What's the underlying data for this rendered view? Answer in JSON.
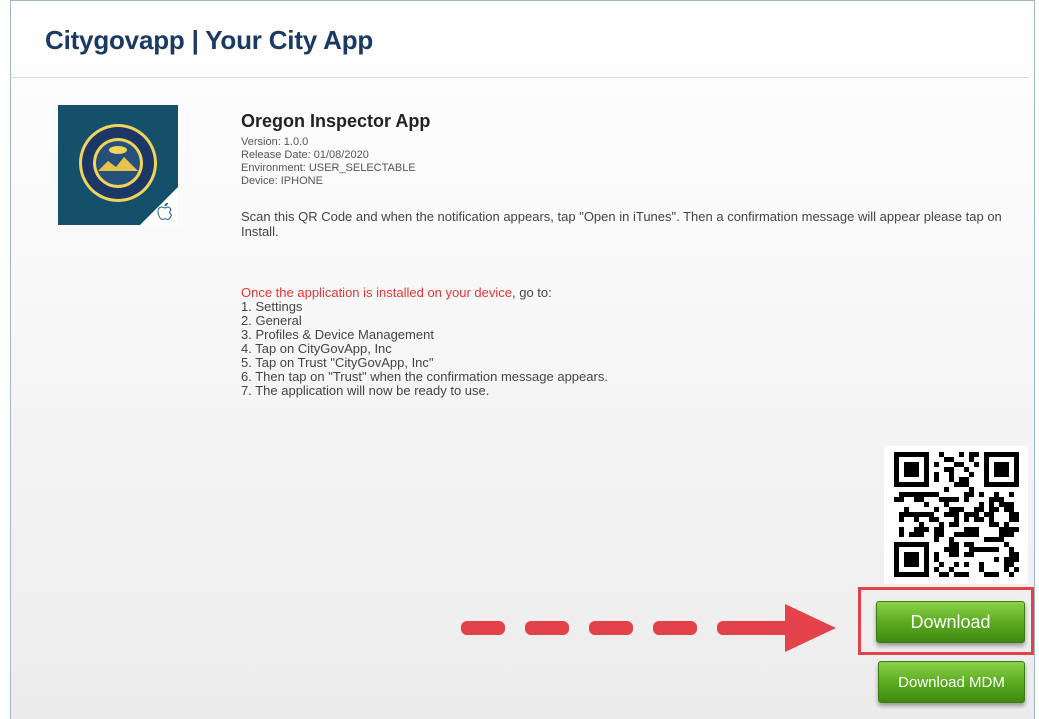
{
  "header": {
    "title": "Citygovapp | Your City App"
  },
  "app": {
    "name": "Oregon Inspector App",
    "version": "Version: 1.0.0",
    "release_date": "Release Date: 01/08/2020",
    "environment": "Environment: USER_SELECTABLE",
    "device": "Device: IPHONE",
    "icon": "oregon-state-seal-icon"
  },
  "instructions": {
    "scan": "Scan this QR Code and when the notification appears, tap \"Open in iTunes\". Then a confirmation message will appear please tap on Install.",
    "installed_highlight": "Once the application is installed on your device",
    "installed_suffix": ", go to:",
    "steps": [
      "1. Settings",
      "2. General",
      "3. Profiles & Device Management",
      "4. Tap on CityGovApp, Inc",
      "5. Tap on Trust \"CityGovApp, Inc\"",
      "6. Then tap on \"Trust\" when the confirmation message appears.",
      "7. The application will now be ready to use."
    ]
  },
  "buttons": {
    "download": "Download",
    "download_mdm": "Download MDM"
  },
  "colors": {
    "accent_red": "#e3424a",
    "button_green": "#58a81d",
    "title_blue": "#1b3a63"
  }
}
